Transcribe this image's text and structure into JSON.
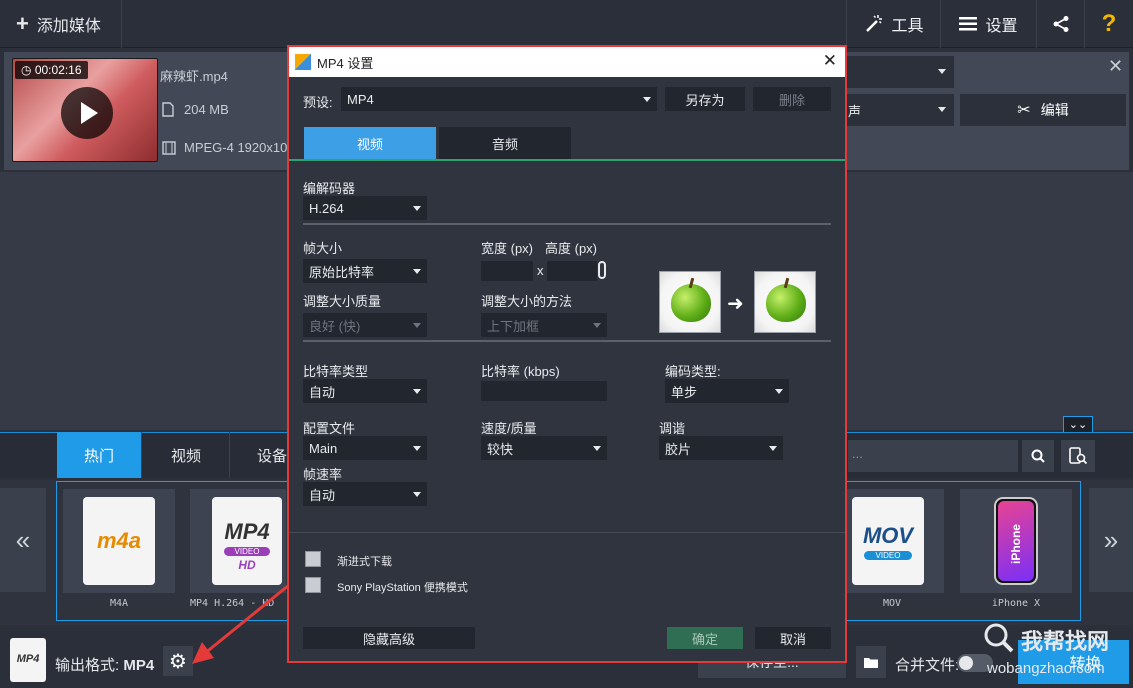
{
  "topbar": {
    "add_media": "添加媒体",
    "tools": "工具",
    "settings": "设置"
  },
  "media": {
    "time": "00:02:16",
    "filename": "麻辣虾.mp4",
    "size": "204 MB",
    "format": "MPEG-4 1920x10",
    "audio_select_fragment": "声",
    "edit_label": "编辑"
  },
  "format_tabs": [
    "热门",
    "视频",
    "设备"
  ],
  "search_placeholder": "...",
  "cards": [
    {
      "label": "M4A",
      "icon_text": "m4a"
    },
    {
      "label": "MP4 H.264 - HD",
      "icon_text": "MP4",
      "sub": "VIDEO",
      "sub2": "HD"
    },
    {
      "label": "MOV",
      "icon_text": "MOV",
      "sub": "VIDEO"
    },
    {
      "label": "iPhone X",
      "icon_text": "iPhone"
    }
  ],
  "bottom": {
    "output_label": "输出格式:",
    "output_value": "MP4",
    "save_label": "保存至...",
    "merge_label": "合并文件:",
    "badge": "MP4"
  },
  "dialog": {
    "title": "MP4 设置",
    "preset_label": "预设:",
    "preset_value": "MP4",
    "save_as": "另存为",
    "delete": "删除",
    "tab_video": "视频",
    "tab_audio": "音频",
    "codec_label": "编解码器",
    "codec_value": "H.264",
    "frame_size_label": "帧大小",
    "frame_size_value": "原始比特率",
    "width_label": "宽度 (px)",
    "height_label": "高度 (px)",
    "x": "x",
    "resize_quality_label": "调整大小质量",
    "resize_quality_value": "良好 (快)",
    "resize_method_label": "调整大小的方法",
    "resize_method_value": "上下加框",
    "bitrate_type_label": "比特率类型",
    "bitrate_type_value": "自动",
    "bitrate_label": "比特率 (kbps)",
    "encode_type_label": "编码类型:",
    "encode_type_value": "单步",
    "profile_label": "配置文件",
    "profile_value": "Main",
    "speed_label": "速度/质量",
    "speed_value": "较快",
    "tune_label": "调谐",
    "tune_value": "胶片",
    "fps_label": "帧速率",
    "fps_value": "自动",
    "progressive_label": "渐进式下载",
    "psp_label": "Sony PlayStation 便携模式",
    "hide_advanced": "隐藏高级",
    "ok": "确定",
    "cancel": "取消"
  },
  "watermark": {
    "line1": "我帮找网",
    "line2": "wobangzhao.com",
    "line3": "转换"
  },
  "colors": {
    "accent": "#1f9be8",
    "dialog_border": "#e53a3a",
    "ok_green": "#2f6e52"
  }
}
